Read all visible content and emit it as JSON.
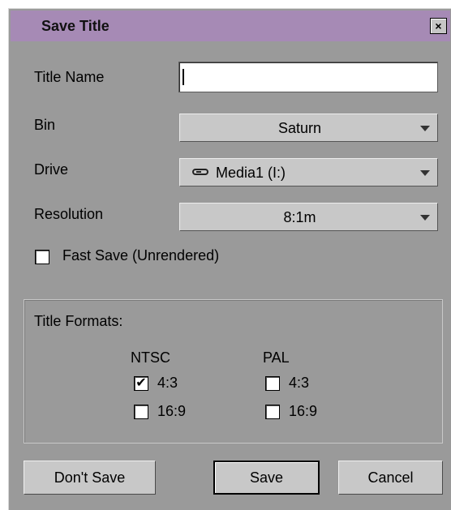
{
  "dialog": {
    "title": "Save Title",
    "close_glyph": "×",
    "close_icon": "close-icon"
  },
  "form": {
    "title_name_label": "Title Name",
    "title_name_value": "",
    "bin_label": "Bin",
    "bin_value": "Saturn",
    "drive_label": "Drive",
    "drive_value": "Media1 (I:)",
    "drive_icon": "drive-icon",
    "resolution_label": "Resolution",
    "resolution_value": "8:1m",
    "fast_save_label": "Fast Save (Unrendered)",
    "fast_save_checked": false
  },
  "formats": {
    "heading": "Title Formats:",
    "ntsc": {
      "label": "NTSC",
      "options": [
        {
          "label": "4:3",
          "checked": true,
          "mark": "✔"
        },
        {
          "label": "16:9",
          "checked": false,
          "mark": ""
        }
      ]
    },
    "pal": {
      "label": "PAL",
      "options": [
        {
          "label": "4:3",
          "checked": false,
          "mark": ""
        },
        {
          "label": "16:9",
          "checked": false,
          "mark": ""
        }
      ]
    }
  },
  "buttons": {
    "dont_save": "Don't Save",
    "save": "Save",
    "cancel": "Cancel"
  },
  "colors": {
    "titlebar": "#a68ab5",
    "dialog_bg": "#9a9a9a",
    "control_bg": "#c8c8c8"
  }
}
